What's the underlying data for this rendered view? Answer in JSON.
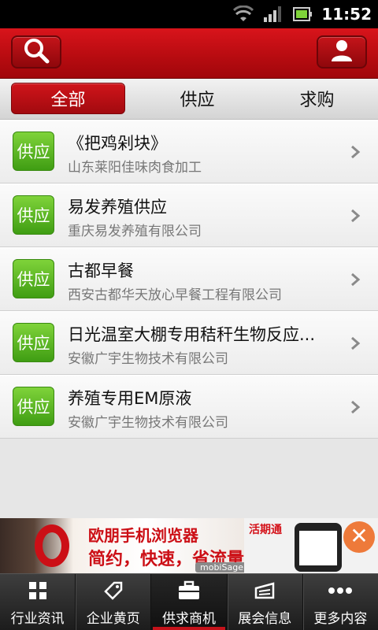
{
  "status_bar": {
    "time": "11:52"
  },
  "header": {
    "search_icon": "search-icon",
    "user_icon": "user-icon"
  },
  "tabs": [
    {
      "label": "全部",
      "selected": true
    },
    {
      "label": "供应",
      "selected": false
    },
    {
      "label": "求购",
      "selected": false
    }
  ],
  "list": [
    {
      "badge": "供应",
      "title": "《把鸡剁块》",
      "subtitle": "山东莱阳佳味肉食加工"
    },
    {
      "badge": "供应",
      "title": "易发养殖供应",
      "subtitle": "重庆易发养殖有限公司"
    },
    {
      "badge": "供应",
      "title": "古都早餐",
      "subtitle": "西安古都华天放心早餐工程有限公司"
    },
    {
      "badge": "供应",
      "title": "日光温室大棚专用秸秆生物反应...",
      "subtitle": "安徽广宇生物技术有限公司"
    },
    {
      "badge": "供应",
      "title": " 养殖专用EM原液",
      "subtitle": "安徽广宇生物技术有限公司"
    }
  ],
  "ad": {
    "headline": "欧朋手机浏览器",
    "tagline": "简约，快速，省流量!",
    "network": "mobiSage",
    "right_logo": "活期通"
  },
  "bottom_nav": [
    {
      "label": "行业资讯",
      "icon": "grid-icon",
      "active": false
    },
    {
      "label": "企业黄页",
      "icon": "tag-icon",
      "active": false
    },
    {
      "label": "供求商机",
      "icon": "briefcase-icon",
      "active": true
    },
    {
      "label": "展会信息",
      "icon": "exhibition-icon",
      "active": false
    },
    {
      "label": "更多内容",
      "icon": "more-icon",
      "active": false
    }
  ],
  "colors": {
    "header_red": "#c4121a",
    "badge_green": "#5cb826",
    "nav_bg": "#2a2a2a"
  }
}
